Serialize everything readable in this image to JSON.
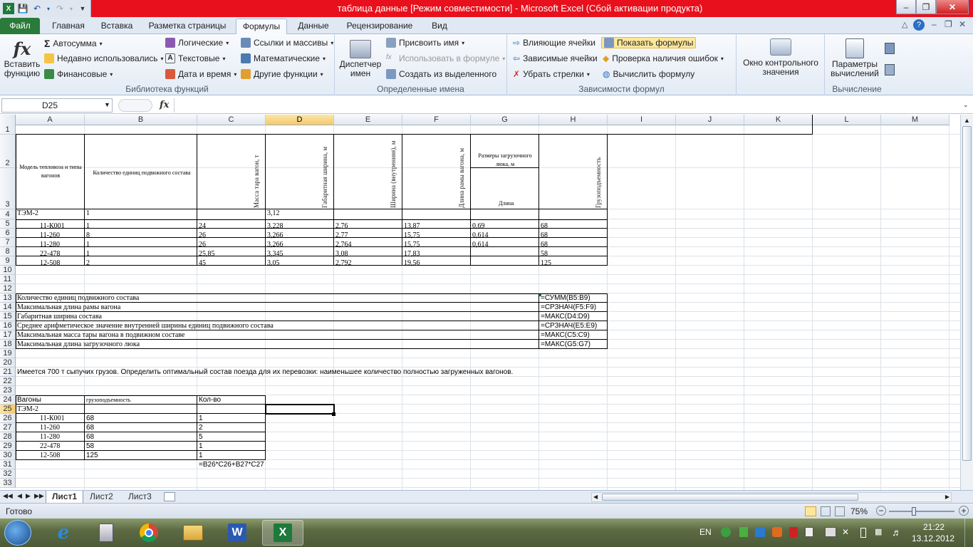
{
  "window": {
    "title": "таблица данные  [Режим совместимости]  -  Microsoft Excel (Сбой активации продукта)"
  },
  "tabs": [
    "Файл",
    "Главная",
    "Вставка",
    "Разметка страницы",
    "Формулы",
    "Данные",
    "Рецензирование",
    "Вид"
  ],
  "ribbon": {
    "insert_function": "Вставить функцию",
    "lib": {
      "autosum": "Автосумма",
      "recent": "Недавно использовались",
      "financial": "Финансовые",
      "logical": "Логические",
      "text": "Текстовые",
      "datetime": "Дата и время",
      "refs": "Ссылки и массивы",
      "math": "Математические",
      "other": "Другие функции",
      "label": "Библиотека функций"
    },
    "names": {
      "manager": "Диспетчер имен",
      "assign": "Присвоить имя",
      "use": "Использовать в формуле",
      "create": "Создать из выделенного",
      "label": "Определенные имена"
    },
    "audit": {
      "precedents": "Влияющие ячейки",
      "dependents": "Зависимые ячейки",
      "remove": "Убрать стрелки",
      "show": "Показать формулы",
      "errors": "Проверка наличия ошибок",
      "evaluate": "Вычислить формулу",
      "label": "Зависимости формул"
    },
    "watch": "Окно контрольного значения",
    "calc": {
      "options": "Параметры вычислений",
      "label": "Вычисление"
    }
  },
  "formula_bar": {
    "namebox": "D25",
    "fx": "fx",
    "value": ""
  },
  "columns": [
    "A",
    "B",
    "C",
    "D",
    "E",
    "F",
    "G",
    "H",
    "I",
    "J",
    "K",
    "L",
    "M"
  ],
  "rows": [
    "1",
    "2",
    "3",
    "4",
    "5",
    "6",
    "7",
    "8",
    "9",
    "10",
    "11",
    "12",
    "13",
    "14",
    "15",
    "16",
    "17",
    "18",
    "19",
    "20",
    "21",
    "22",
    "23",
    "24",
    "25",
    "26",
    "27",
    "28",
    "29",
    "30",
    "31",
    "32",
    "33"
  ],
  "sheet": {
    "header_group": "Характеристики единиц подвижного состава",
    "a2": "Модель тепловоза и типы вагонов",
    "b2": "Количество единиц подвижного состава",
    "c_head": "Масса тара вагон, т",
    "d_head": "Габаритная ширина, м",
    "e_head": "Ширина (внутренняя), м",
    "f_head": "Длина рамы вагона, м",
    "g_head": "Размеры загрузочного люка, м",
    "g3": "Длина",
    "h_head": "Грузоподъемность",
    "r4": [
      "ТЭМ-2",
      "1",
      "",
      "3,12",
      "",
      "",
      "",
      ""
    ],
    "r5": [
      "11-К001",
      "1",
      "24",
      "3,228",
      "2,76",
      "13,87",
      "0,69",
      "68"
    ],
    "r6": [
      "11-260",
      "8",
      "26",
      "3,266",
      "2,77",
      "15,75",
      "0,614",
      "68"
    ],
    "r7": [
      "11-280",
      "1",
      "26",
      "3,266",
      "2,764",
      "15,75",
      "0,614",
      "68"
    ],
    "r8": [
      "22-478",
      "1",
      "25,85",
      "3,345",
      "3,08",
      "17,83",
      "",
      "58"
    ],
    "r9": [
      "12-508",
      "2",
      "45",
      "3,05",
      "2,792",
      "19,56",
      "",
      "125"
    ],
    "summary": [
      {
        "label": "Количество единиц подвижного состава",
        "formula": "=СУММ(B5:B9)"
      },
      {
        "label": "Максимальная длина рамы вагона",
        "formula": "=СРЗНАЧ(F5:F9)"
      },
      {
        "label": "Габаритная ширина состава",
        "formula": "=МАКС(D4:D9)"
      },
      {
        "label": "Среднее арифметическое значение внутренней ширины единиц подвижного состава",
        "formula": "=СРЗНАЧ(E5:E9)"
      },
      {
        "label": "Максимальная масса тары вагона в подвижном составе",
        "formula": "=МАКС(C5:C9)"
      },
      {
        "label": "Максимальная длина загрузочного люка",
        "formula": "=МАКС(G5:G7)"
      }
    ],
    "r21": "Имеется 700 т сыпучих грузов. Определить оптимальный состав поезда для их перевозки: наименьшее количество полностью загруженных вагонов.",
    "r24": [
      "Вагоны",
      "грузоподъемность",
      "Кол-во"
    ],
    "r25": "ТЭМ-2",
    "wagons": [
      [
        "11-К001",
        "68",
        "1"
      ],
      [
        "11-260",
        "68",
        "2"
      ],
      [
        "11-280",
        "68",
        "5"
      ],
      [
        "22-478",
        "58",
        "1"
      ],
      [
        "12-508",
        "125",
        "1"
      ]
    ],
    "r31": "=B26*C26+B27*C27"
  },
  "sheet_tabs": [
    "Лист1",
    "Лист2",
    "Лист3"
  ],
  "status": {
    "ready": "Готово",
    "zoom": "75%"
  },
  "taskbar": {
    "lang": "EN",
    "time": "21:22",
    "date": "13.12.2012"
  }
}
